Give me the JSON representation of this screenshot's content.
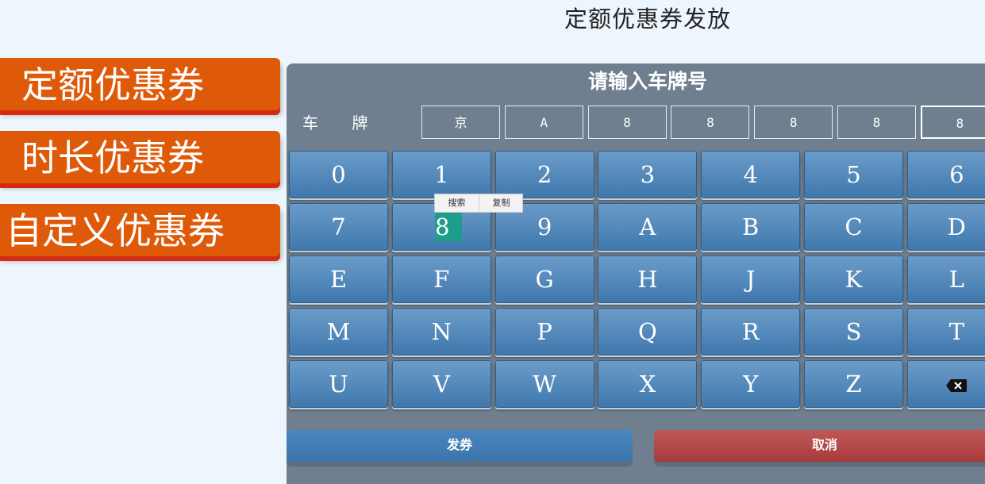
{
  "page": {
    "title": "定额优惠券发放"
  },
  "menu": {
    "items": [
      {
        "label": "定额优惠券"
      },
      {
        "label": "时长优惠券"
      },
      {
        "label": "自定义优惠券"
      }
    ]
  },
  "panel": {
    "title": "请输入车牌号",
    "plate_label": "车 牌",
    "plate_chars": [
      "京",
      "A",
      "8",
      "8",
      "8",
      "8",
      "8"
    ]
  },
  "keys": [
    [
      "0",
      "1",
      "2",
      "3",
      "4",
      "5",
      "6"
    ],
    [
      "7",
      "8",
      "9",
      "A",
      "B",
      "C",
      "D"
    ],
    [
      "E",
      "F",
      "G",
      "H",
      "J",
      "K",
      "L"
    ],
    [
      "M",
      "N",
      "P",
      "Q",
      "R",
      "S",
      "T"
    ],
    [
      "U",
      "V",
      "W",
      "X",
      "Y",
      "Z",
      ""
    ]
  ],
  "delete_key": {
    "icon": "backspace-icon"
  },
  "context_menu": {
    "search": "搜索",
    "copy": "复制"
  },
  "selection": {
    "text": "8"
  },
  "actions": {
    "issue": "发券",
    "cancel": "取消"
  },
  "colors": {
    "menu": "#de5a08",
    "key": "#4a82b8",
    "panel": "#6f7f8f",
    "cancel": "#b04646"
  }
}
